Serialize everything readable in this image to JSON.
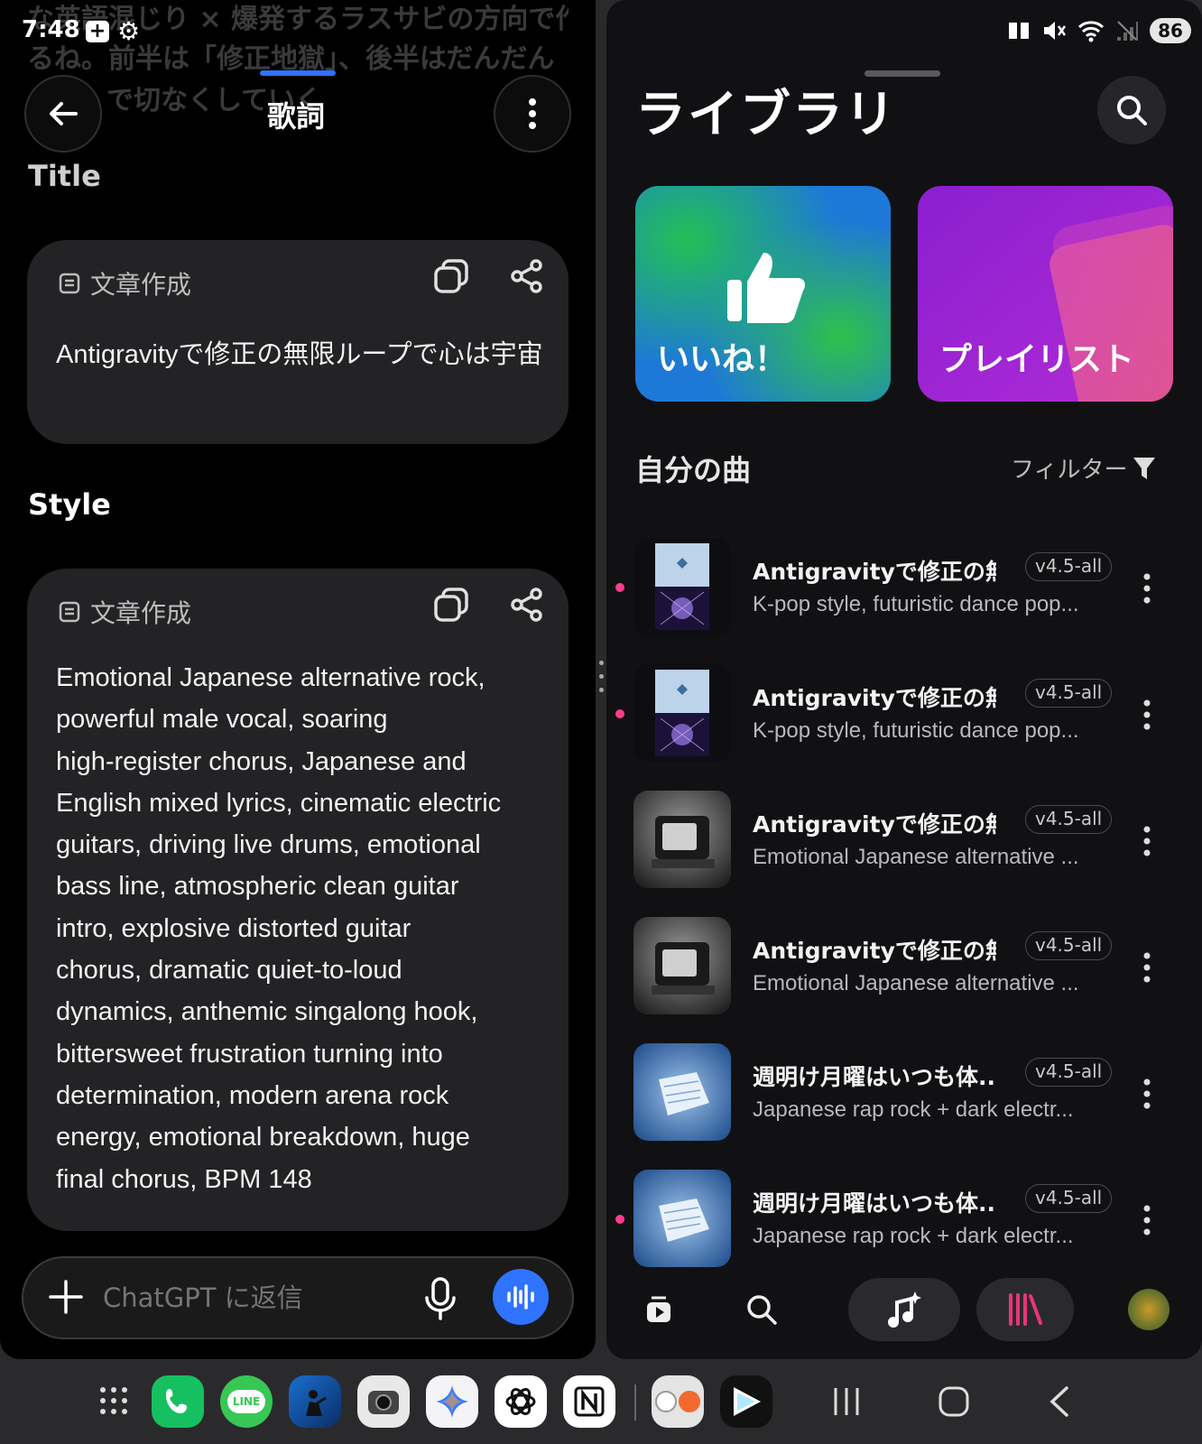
{
  "status_bar": {
    "time": "7:48",
    "battery": "86"
  },
  "left": {
    "ghost_lines": [
      "な英語混じり × 爆発するラスサビの方向で作",
      "るね。前半は「修正地獄」、後半はだんだん",
      "で切なくしていく"
    ],
    "header_title": "歌詞",
    "title_label": "Title",
    "style_label": "Style",
    "title_card": {
      "tag": "文章作成",
      "text": "Antigravityで修正の無限ループで心は宇宙"
    },
    "style_card": {
      "tag": "文章作成",
      "lines": [
        "Emotional Japanese alternative rock,",
        "powerful male vocal, soaring",
        "high-register chorus, Japanese and",
        "English mixed lyrics, cinematic electric",
        "guitars, driving live drums, emotional",
        "bass line, atmospheric clean guitar",
        "intro, explosive distorted guitar",
        "chorus, dramatic quiet-to-loud",
        "dynamics, anthemic singalong hook,",
        "bittersweet frustration turning into",
        "determination, modern arena rock",
        "energy, emotional breakdown, huge",
        "final chorus, BPM 148"
      ]
    },
    "composer": {
      "placeholder": "ChatGPT に返信"
    }
  },
  "right": {
    "title": "ライブラリ",
    "tiles": {
      "liked": "いいね！",
      "playlist": "プレイリスト"
    },
    "section_title": "自分の曲",
    "filter_label": "フィルター",
    "songs": [
      {
        "title": "Antigravityで修正の無...",
        "version": "v4.5-all",
        "desc": "K-pop style, futuristic dance pop...",
        "thumb": "galaxy"
      },
      {
        "title": "Antigravityで修正の無...",
        "version": "v4.5-all",
        "desc": "K-pop style, futuristic dance pop...",
        "thumb": "galaxy"
      },
      {
        "title": "Antigravityで修正の無...",
        "version": "v4.5-all",
        "desc": "Emotional Japanese alternative ...",
        "thumb": "tv"
      },
      {
        "title": "Antigravityで修正の無...",
        "version": "v4.5-all",
        "desc": "Emotional Japanese alternative ...",
        "thumb": "tv"
      },
      {
        "title": "週明け月曜はいつも体...",
        "version": "v4.5-all",
        "desc": "Japanese rap rock + dark electr...",
        "thumb": "paper"
      },
      {
        "title": "週明け月曜はいつも体...",
        "version": "v4.5-all",
        "desc": "Japanese rap rock + dark electr...",
        "thumb": "paper"
      }
    ]
  },
  "colors": {
    "accent_blue": "#2f73ff",
    "pink": "#ff3d8a",
    "library_pink": "#e8357a"
  }
}
